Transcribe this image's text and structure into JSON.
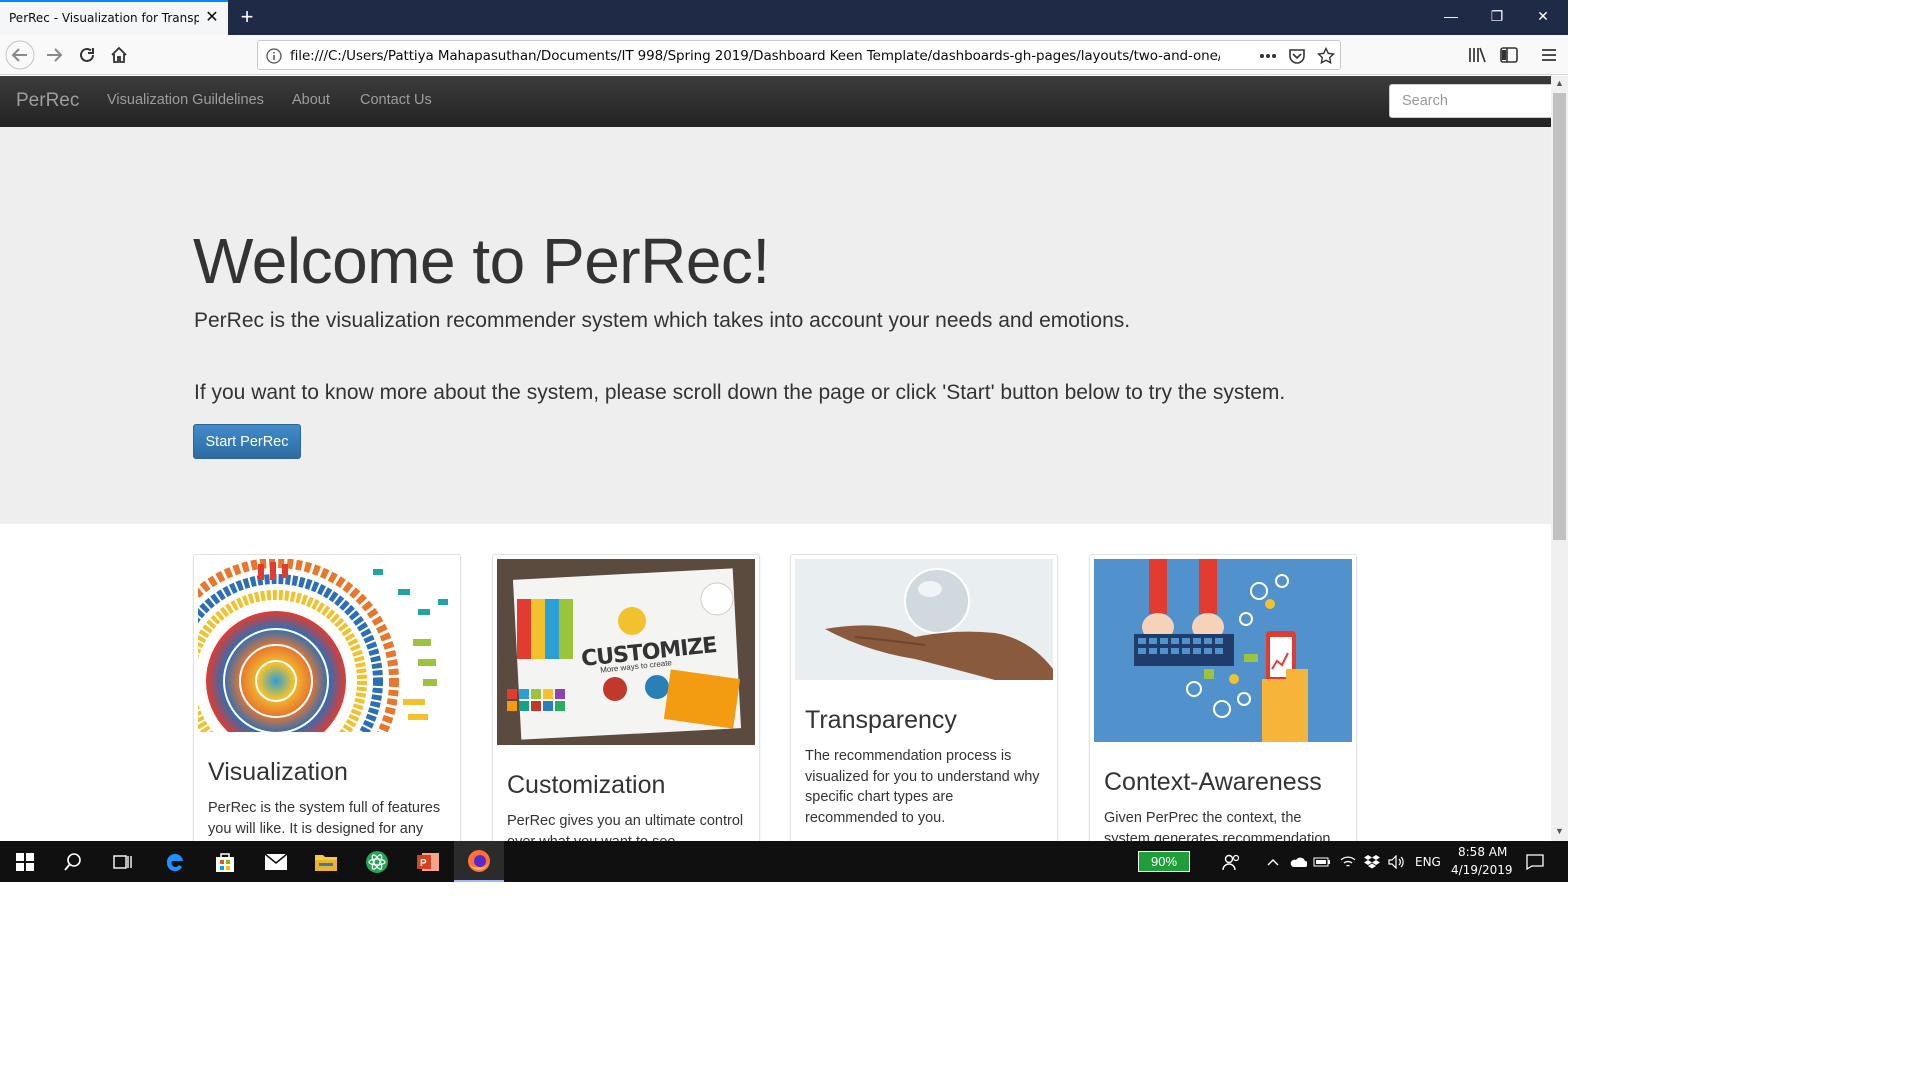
{
  "browser": {
    "tab_title": "PerRec - Visualization for Transparency",
    "url": "file:///C:/Users/Pattiya Mahapasuthan/Documents/IT 998/Spring 2019/Dashboard Keen Template/dashboards-gh-pages/layouts/two-and-one/PerRec_"
  },
  "site_nav": {
    "brand": "PerRec",
    "links": [
      "Visualization Guildelines",
      "About",
      "Contact Us"
    ],
    "search_placeholder": "Search"
  },
  "hero": {
    "title": "Welcome to PerRec!",
    "subtitle": "PerRec is the visualization recommender system which takes into account your needs and emotions.",
    "instruction": "If you want to know more about the system, please scroll down the page or click 'Start' button below to try the system.",
    "button": "Start PerRec"
  },
  "cards": [
    {
      "title": "Visualization",
      "text": "PerRec is the system full of features you will like. It is designed for any"
    },
    {
      "title": "Customization",
      "text": "PerRec gives you an ultimate control over what you want to see.",
      "image_caption": "CUSTOMIZE",
      "image_subcaption": "More ways to create"
    },
    {
      "title": "Transparency",
      "text": "The recommendation process is visualized for you to understand why specific chart types are recommended to you."
    },
    {
      "title": "Context-Awareness",
      "text": "Given PerPrec the context, the system generates recommendation"
    }
  ],
  "taskbar": {
    "battery": "90%",
    "language": "ENG",
    "time": "8:58 AM",
    "date": "4/19/2019"
  }
}
